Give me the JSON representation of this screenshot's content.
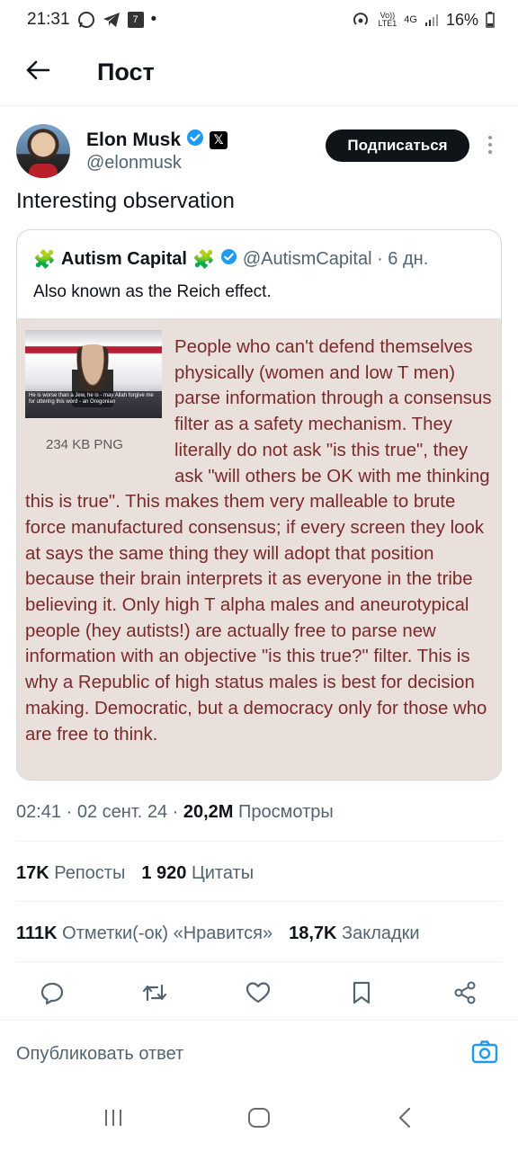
{
  "status_bar": {
    "time": "21:31",
    "app_badge": "7",
    "dot": "•",
    "volte_top": "Vo))",
    "volte_bottom": "LTE1",
    "network": "4G",
    "battery": "16%"
  },
  "header": {
    "title": "Пост"
  },
  "author": {
    "name": "Elon Musk",
    "handle": "@elonmusk",
    "x_badge": "𝕏",
    "follow_label": "Подписаться"
  },
  "tweet": {
    "text": "Interesting observation"
  },
  "quote": {
    "emoji": "🧩",
    "name": "Autism Capital",
    "handle_time": "@AutismCapital · 6 дн.",
    "text": "Also known as the Reich effect.",
    "image": {
      "size_label": "234 KB PNG",
      "caption": "He is worse than a Jew, he is - may Allah forgive me for uttering this word - an Oregonian",
      "body": "People who can't defend themselves physically (women and low T men) parse information through a consensus filter as a safety mechanism. They literally do not ask \"is this true\", they ask \"will others be OK with me thinking this is true\". This makes them very malleable to brute force manufactured consensus; if every screen they look at says the same thing they will adopt that position because their brain interprets it as everyone in the tribe believing it. Only high T alpha males and aneurotypical people (hey autists!) are actually free to parse new information with an objective \"is this true?\" filter. This is why a Republic of high status males is best for decision making. Democratic, but a democracy only for those who are free to think."
    }
  },
  "meta": {
    "time_date": "02:41 · 02 сент. 24 · ",
    "views": "20,2M",
    "views_label": " Просмотры"
  },
  "stats": {
    "reposts": "17K",
    "reposts_label": "Репосты",
    "quotes": "1 920",
    "quotes_label": "Цитаты",
    "likes": "111K",
    "likes_label": "Отметки(-ок) «Нравится»",
    "bookmarks": "18,7K",
    "bookmarks_label": "Закладки"
  },
  "reply": {
    "placeholder": "Опубликовать ответ"
  },
  "colors": {
    "accent": "#1d9bf0",
    "text": "#0f1419",
    "muted": "#536471",
    "meme_text": "#7a2a2a",
    "meme_bg": "#eae0db"
  },
  "icons": [
    "back-arrow-icon",
    "verified-icon",
    "x-logo-icon",
    "more-icon",
    "puzzle-icon",
    "reply-icon",
    "repost-icon",
    "like-icon",
    "bookmark-icon",
    "share-icon",
    "camera-icon"
  ]
}
